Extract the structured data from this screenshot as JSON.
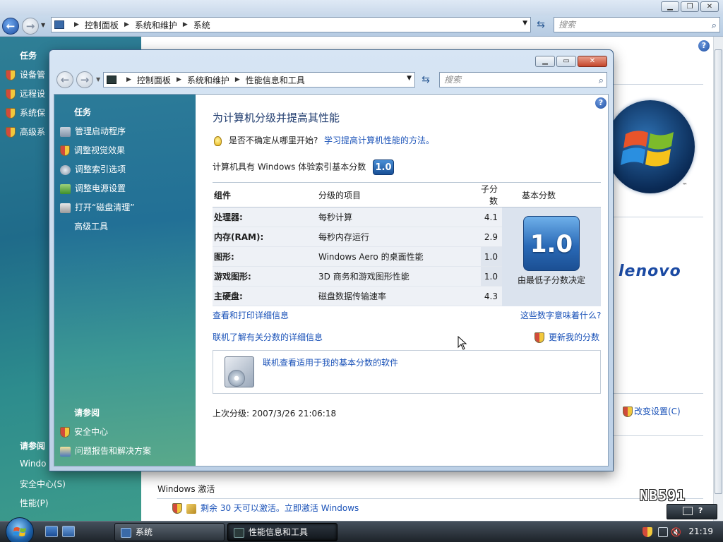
{
  "bg_window": {
    "breadcrumb": [
      "控制面板",
      "系统和维护",
      "系统"
    ],
    "search_placeholder": "搜索",
    "sidebar": {
      "tasks_heading": "任务",
      "tasks": [
        "设备管",
        "远程设",
        "系统保",
        "高级系"
      ],
      "see_also_heading": "请参阅",
      "see_also": [
        "Windo",
        "安全中心(S)",
        "性能(P)"
      ]
    },
    "change_settings": "改变设置(C)",
    "activation_heading": "Windows 激活",
    "activation_text": "剩余 30 天可以激活。立即激活 Windows",
    "brand_text": "lenovo",
    "tm": "™"
  },
  "fg_window": {
    "breadcrumb": [
      "控制面板",
      "系统和维护",
      "性能信息和工具"
    ],
    "search_placeholder": "搜索",
    "sidebar": {
      "tasks_heading": "任务",
      "tasks": [
        "管理启动程序",
        "调整视觉效果",
        "调整索引选项",
        "调整电源设置",
        "打开“磁盘清理”",
        "高级工具"
      ],
      "see_also_heading": "请参阅",
      "see_also": [
        "安全中心",
        "问题报告和解决方案"
      ]
    },
    "main": {
      "title": "为计算机分级并提高其性能",
      "tip_question": "是否不确定从哪里开始?",
      "tip_link": "学习提高计算机性能的方法。",
      "base_score_label": "计算机具有 Windows 体验索引基本分数",
      "base_score": "1.0",
      "table": {
        "headers": [
          "组件",
          "分级的项目",
          "子分数",
          "基本分数"
        ],
        "rows": [
          {
            "component": "处理器:",
            "item": "每秒计算",
            "subscore": "4.1"
          },
          {
            "component": "内存(RAM):",
            "item": "每秒内存运行",
            "subscore": "2.9"
          },
          {
            "component": "图形:",
            "item": "Windows Aero 的桌面性能",
            "subscore": "1.0"
          },
          {
            "component": "游戏图形:",
            "item": "3D 商务和游戏图形性能",
            "subscore": "1.0"
          },
          {
            "component": "主硬盘:",
            "item": "磁盘数据传输速率",
            "subscore": "4.3"
          }
        ],
        "base_note": "由最低子分数决定"
      },
      "link_view_print": "查看和打印详细信息",
      "link_meaning": "这些数字意味着什么?",
      "link_online_details": "联机了解有关分数的详细信息",
      "link_update_score": "更新我的分数",
      "link_software": "联机查看适用于我的基本分数的软件",
      "last_rated": "上次分级: 2007/3/26 21:06:18"
    }
  },
  "taskbar": {
    "buttons": [
      "系统",
      "性能信息和工具"
    ],
    "clock": "21:19"
  },
  "watermark": "NB591",
  "colors": {
    "link": "#1a52b8",
    "sidebar": "#227096",
    "title": "#1f3b6e"
  }
}
